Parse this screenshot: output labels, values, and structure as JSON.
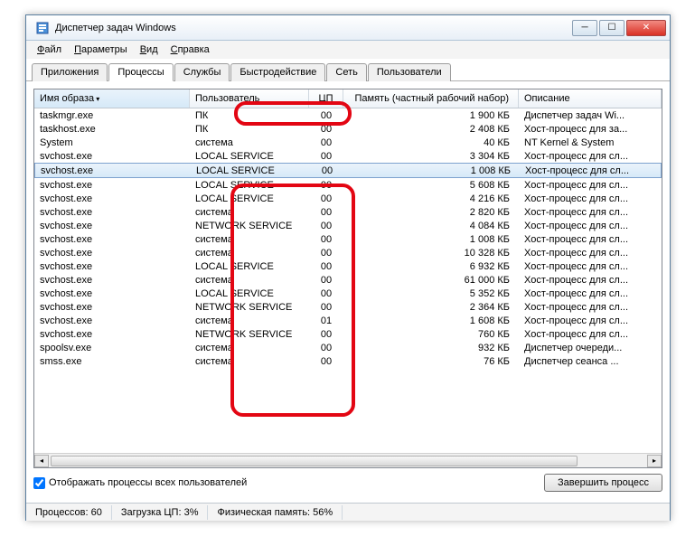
{
  "window": {
    "title": "Диспетчер задач Windows"
  },
  "menu": {
    "file": "Файл",
    "options": "Параметры",
    "view": "Вид",
    "help": "Справка"
  },
  "tabs": [
    "Приложения",
    "Процессы",
    "Службы",
    "Быстродействие",
    "Сеть",
    "Пользователи"
  ],
  "active_tab": 1,
  "columns": {
    "image": "Имя образа",
    "user": "Пользователь",
    "cpu": "ЦП",
    "memory": "Память (частный рабочий набор)",
    "description": "Описание"
  },
  "rows": [
    {
      "img": "taskmgr.exe",
      "user": "ПК",
      "cpu": "00",
      "mem": "1 900 КБ",
      "desc": "Диспетчер задач Wi...",
      "sel": false
    },
    {
      "img": "taskhost.exe",
      "user": "ПК",
      "cpu": "00",
      "mem": "2 408 КБ",
      "desc": "Хост-процесс для за...",
      "sel": false
    },
    {
      "img": "System",
      "user": "система",
      "cpu": "00",
      "mem": "40 КБ",
      "desc": "NT Kernel & System",
      "sel": false
    },
    {
      "img": "svchost.exe",
      "user": "LOCAL SERVICE",
      "cpu": "00",
      "mem": "3 304 КБ",
      "desc": "Хост-процесс для сл...",
      "sel": false
    },
    {
      "img": "svchost.exe",
      "user": "LOCAL SERVICE",
      "cpu": "00",
      "mem": "1 008 КБ",
      "desc": "Хост-процесс для сл...",
      "sel": true
    },
    {
      "img": "svchost.exe",
      "user": "LOCAL SERVICE",
      "cpu": "00",
      "mem": "5 608 КБ",
      "desc": "Хост-процесс для сл...",
      "sel": false
    },
    {
      "img": "svchost.exe",
      "user": "LOCAL SERVICE",
      "cpu": "00",
      "mem": "4 216 КБ",
      "desc": "Хост-процесс для сл...",
      "sel": false
    },
    {
      "img": "svchost.exe",
      "user": "система",
      "cpu": "00",
      "mem": "2 820 КБ",
      "desc": "Хост-процесс для сл...",
      "sel": false
    },
    {
      "img": "svchost.exe",
      "user": "NETWORK SERVICE",
      "cpu": "00",
      "mem": "4 084 КБ",
      "desc": "Хост-процесс для сл...",
      "sel": false
    },
    {
      "img": "svchost.exe",
      "user": "система",
      "cpu": "00",
      "mem": "1 008 КБ",
      "desc": "Хост-процесс для сл...",
      "sel": false
    },
    {
      "img": "svchost.exe",
      "user": "система",
      "cpu": "00",
      "mem": "10 328 КБ",
      "desc": "Хост-процесс для сл...",
      "sel": false
    },
    {
      "img": "svchost.exe",
      "user": "LOCAL SERVICE",
      "cpu": "00",
      "mem": "6 932 КБ",
      "desc": "Хост-процесс для сл...",
      "sel": false
    },
    {
      "img": "svchost.exe",
      "user": "система",
      "cpu": "00",
      "mem": "61 000 КБ",
      "desc": "Хост-процесс для сл...",
      "sel": false
    },
    {
      "img": "svchost.exe",
      "user": "LOCAL SERVICE",
      "cpu": "00",
      "mem": "5 352 КБ",
      "desc": "Хост-процесс для сл...",
      "sel": false
    },
    {
      "img": "svchost.exe",
      "user": "NETWORK SERVICE",
      "cpu": "00",
      "mem": "2 364 КБ",
      "desc": "Хост-процесс для сл...",
      "sel": false
    },
    {
      "img": "svchost.exe",
      "user": "система",
      "cpu": "01",
      "mem": "1 608 КБ",
      "desc": "Хост-процесс для сл...",
      "sel": false
    },
    {
      "img": "svchost.exe",
      "user": "NETWORK SERVICE",
      "cpu": "00",
      "mem": "760 КБ",
      "desc": "Хост-процесс для сл...",
      "sel": false
    },
    {
      "img": "spoolsv.exe",
      "user": "система",
      "cpu": "00",
      "mem": "932 КБ",
      "desc": "Диспетчер очереди...",
      "sel": false
    },
    {
      "img": "smss.exe",
      "user": "система",
      "cpu": "00",
      "mem": "76 КБ",
      "desc": "Диспетчер сеанса ...",
      "sel": false
    }
  ],
  "checkbox_label": "Отображать процессы всех пользователей",
  "end_button": "Завершить процесс",
  "status": {
    "procs": "Процессов: 60",
    "cpu": "Загрузка ЦП: 3%",
    "mem": "Физическая память: 56%"
  }
}
